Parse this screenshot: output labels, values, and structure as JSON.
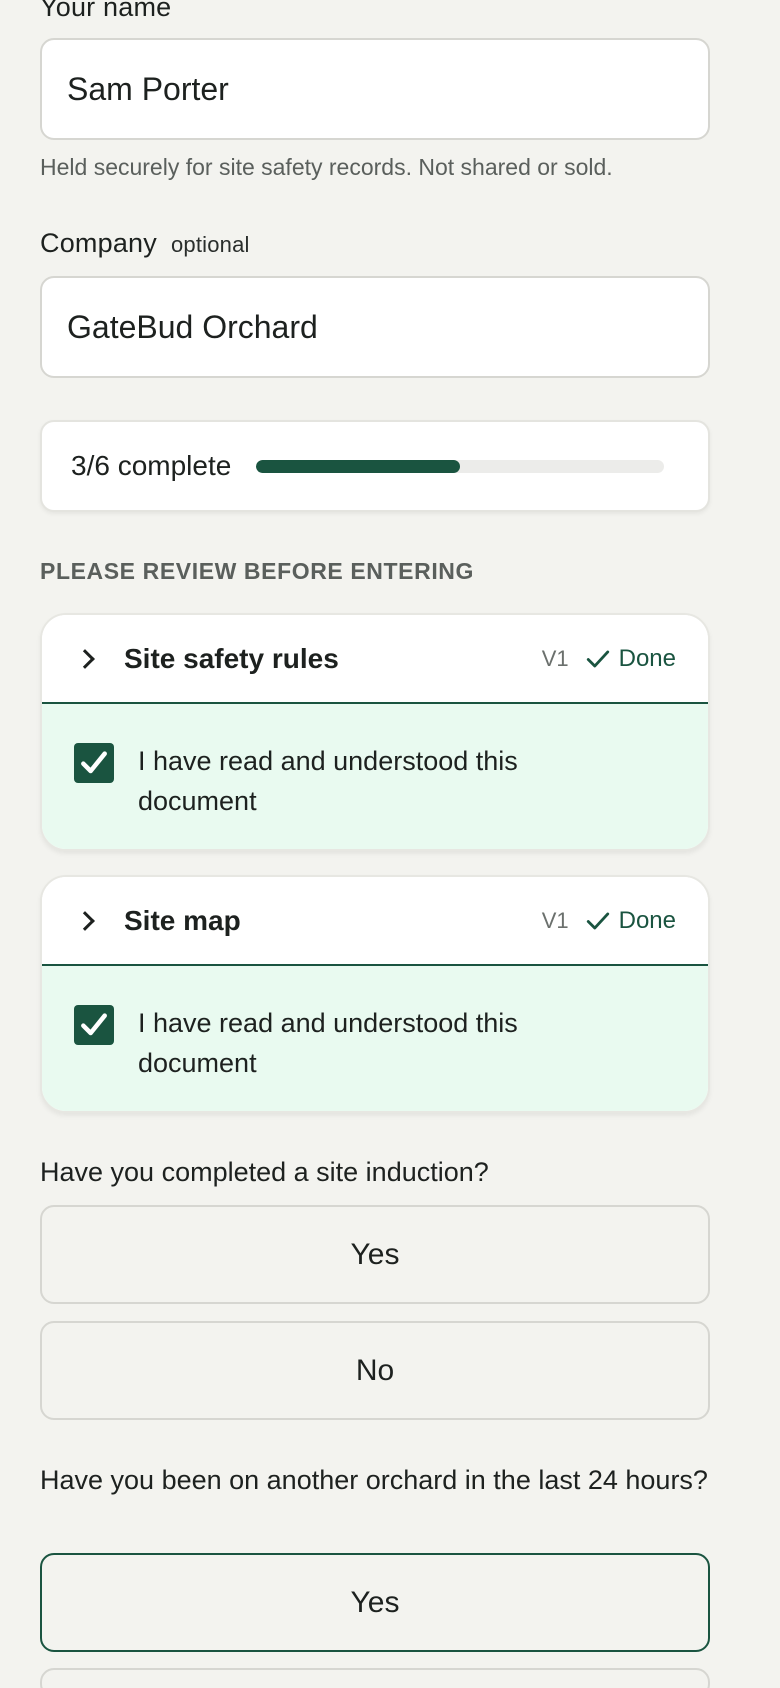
{
  "name_field": {
    "label": "Your name",
    "value": "Sam Porter",
    "help": "Held securely for site safety records. Not shared or sold."
  },
  "company_field": {
    "label": "Company",
    "optional_tag": "optional",
    "value": "GateBud Orchard"
  },
  "progress": {
    "text": "3/6 complete",
    "completed": 3,
    "total": 6,
    "fraction": 0.5
  },
  "review": {
    "heading": "PLEASE REVIEW BEFORE ENTERING",
    "documents": [
      {
        "title": "Site safety rules",
        "version": "V1",
        "status": "Done",
        "acknowledgement": "I have read and understood this document",
        "checked": true
      },
      {
        "title": "Site map",
        "version": "V1",
        "status": "Done",
        "acknowledgement": "I have read and understood this document",
        "checked": true
      }
    ]
  },
  "questions": [
    {
      "text": "Have you completed a site induction?",
      "options": [
        "Yes",
        "No"
      ],
      "selected": null
    },
    {
      "text": "Have you been on another orchard in the last 24 hours?",
      "options": [
        "Yes"
      ],
      "selected": "Yes"
    }
  ],
  "colors": {
    "accent": "#1a5440",
    "page_background": "#f3f3ef",
    "acknowledged_background": "#e9faf0"
  },
  "icons": {
    "chevron": "chevron-right-icon",
    "status": "check-icon",
    "checkbox": "checkbox-checked-icon"
  }
}
